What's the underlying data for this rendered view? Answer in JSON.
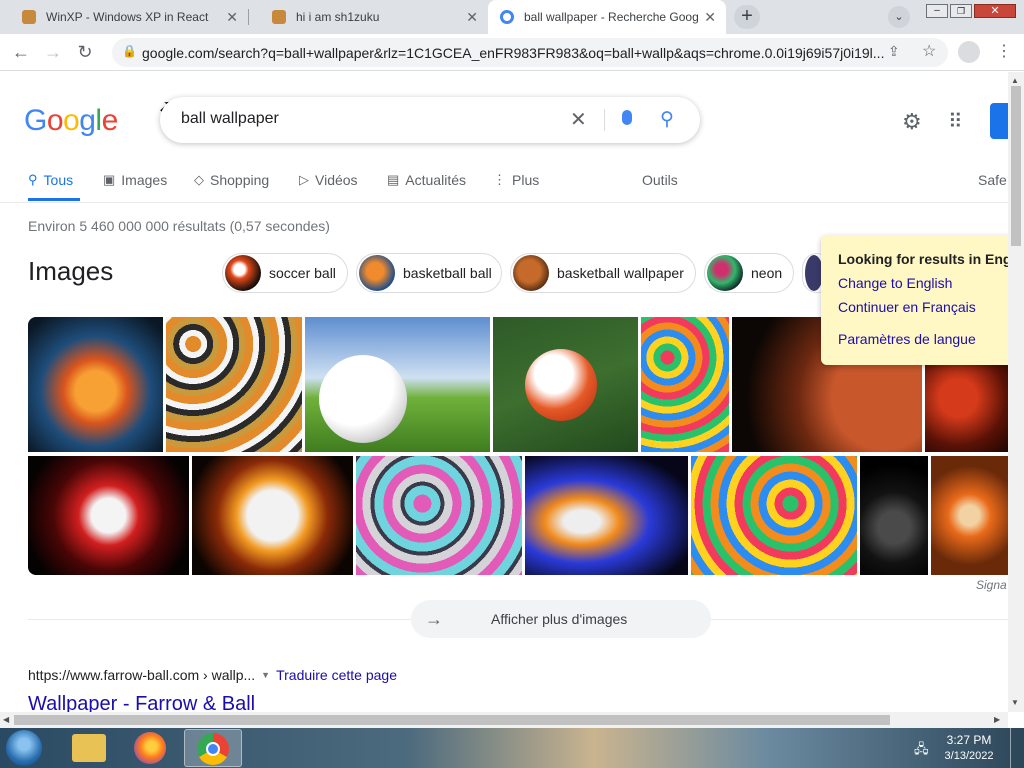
{
  "tabs": [
    {
      "title": "WinXP - Windows XP in React",
      "favicon_color": "#c78a3d"
    },
    {
      "title": "hi i am sh1zuku",
      "favicon_color": "#c78a3d"
    },
    {
      "title": "ball wallpaper - Recherche Goog",
      "favicon_color": "#4285f4"
    }
  ],
  "new_tab_icon": "+",
  "url": "google.com/search?q=ball+wallpaper&rlz=1C1GCEA_enFR983FR983&oq=ball+wallp&aqs=chrome.0.0i19j69i57j0i19l...",
  "logo": {
    "letters": [
      "G",
      "o",
      "o",
      "g",
      "l",
      "e"
    ],
    "colors": [
      "#4285f4",
      "#ea4335",
      "#fbbc05",
      "#4285f4",
      "#34a853",
      "#ea4335"
    ]
  },
  "search": {
    "query": "ball wallpaper"
  },
  "search_tabs": [
    {
      "label": "Tous",
      "icon": "search-icon"
    },
    {
      "label": "Images",
      "icon": "image-icon"
    },
    {
      "label": "Shopping",
      "icon": "tag-icon"
    },
    {
      "label": "Vidéos",
      "icon": "play-icon"
    },
    {
      "label": "Actualités",
      "icon": "news-icon"
    },
    {
      "label": "Plus",
      "icon": "more-vert-icon"
    }
  ],
  "tools_label": "Outils",
  "safe_label": "Safe",
  "results_stats": "Environ 5 460 000 000 résultats (0,57 secondes)",
  "images_heading": "Images",
  "chips": [
    "soccer ball",
    "basketball ball",
    "basketball wallpaper",
    "neon"
  ],
  "language_popup": {
    "title": "Looking for results in Engli",
    "change": "Change to English",
    "continue": "Continuer en Français",
    "settings": "Paramètres de langue"
  },
  "signal_label": "Signa",
  "more_images": "Afficher plus d'images",
  "result": {
    "breadcrumb": "https://www.farrow-ball.com › wallp...",
    "translate": "Traduire cette page",
    "title": "Wallpaper - Farrow & Ball"
  },
  "clock": {
    "time": "3:27 PM",
    "date": "3/13/2022"
  },
  "colors": {
    "accent": "#1a73e8",
    "link": "#1a0dab",
    "popup_bg": "#fff8c5"
  }
}
